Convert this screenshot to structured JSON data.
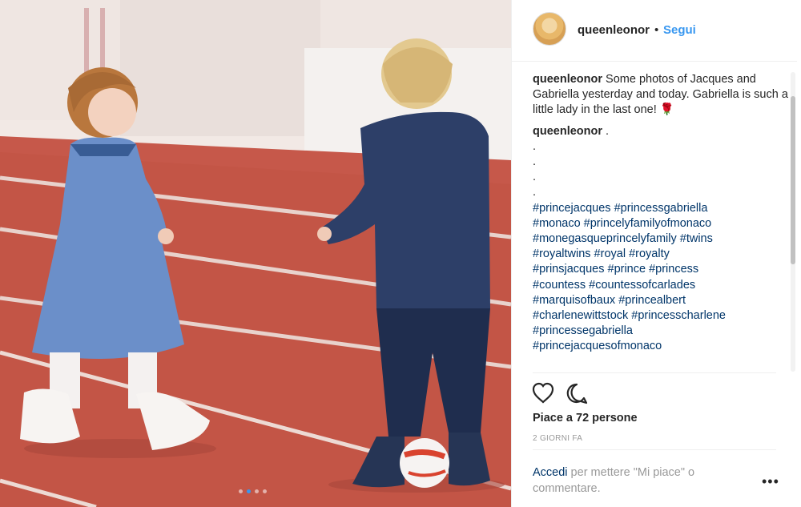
{
  "post": {
    "username": "queenleonor",
    "separator": "•",
    "follow_label": "Segui",
    "carousel": {
      "count": 4,
      "active_index": 1
    }
  },
  "comments": [
    {
      "username": "queenleonor",
      "text": " Some photos of Jacques and Gabriella yesterday and today. Gabriella is such a little lady in the last one! 🌹"
    },
    {
      "username": "queenleonor",
      "text": " ."
    }
  ],
  "dot_lines": [
    ".",
    ".",
    ".",
    "."
  ],
  "hashtag_lines": [
    "#princejacques #princessgabriella",
    "#monaco #princelyfamilyofmonaco",
    "#monegasqueprincelyfamily #twins",
    "#royaltwins #royal #royalty",
    "#prinsjacques #prince #princess",
    "#countess #countessofcarlades",
    "#marquisofbaux #princealbert",
    "#charlenewittstock #princesscharlene",
    "#princessegabriella",
    "#princejacquesofmonaco"
  ],
  "likes_text": "Piace a 72 persone",
  "time_text": "2 GIORNI FA",
  "login": {
    "link": "Accedi",
    "text": " per mettere \"Mi piace\" o commentare."
  },
  "more_label": "•••",
  "icons": {
    "like": "heart-icon",
    "comment": "comment-bubble-icon",
    "more": "more-options-icon"
  },
  "colors": {
    "link_blue": "#3897f0",
    "hashtag": "#003569",
    "track": "#c6584a"
  }
}
